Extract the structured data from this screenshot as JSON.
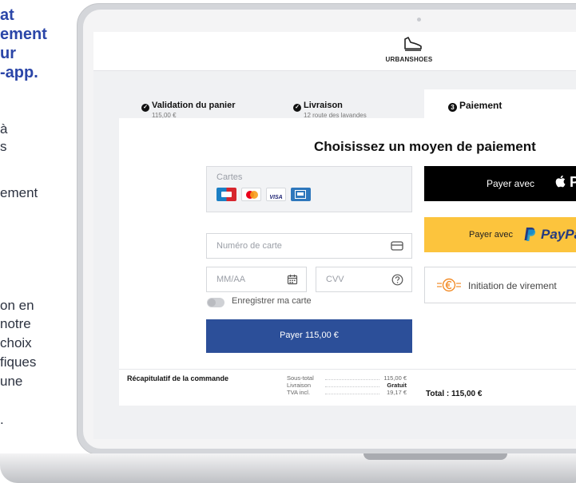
{
  "left_text": {
    "bold_lines": [
      "at",
      "ement",
      "ur",
      "-app."
    ],
    "regular_lines": [
      "à",
      "s",
      "ement",
      "on en",
      "notre",
      "choix",
      "fiques",
      "une",
      "."
    ]
  },
  "brand": {
    "name": "URBANSHOES",
    "logo_icon": "shoe-icon"
  },
  "steps": {
    "cart": {
      "title": "Validation du panier",
      "sub": "115,00 €"
    },
    "delivery": {
      "title": "Livraison",
      "sub": "12 route des lavandes"
    },
    "payment": {
      "number": "3",
      "title": "Paiement"
    }
  },
  "payment": {
    "heading": "Choisissez un moyen de paiement",
    "cards_label": "Cartes",
    "card_brands": [
      "Carte Bancaire",
      "Mastercard",
      "VISA",
      "Amex"
    ],
    "visa_text": "VISA",
    "card_number_placeholder": "Numéro de carte",
    "expiry_placeholder": "MM/AA",
    "cvv_placeholder": "CVV",
    "save_card_label": "Enregistrer ma carte",
    "pay_button": "Payer 115,00 €",
    "apple_pay": {
      "label": "Payer avec",
      "brand": " Pay"
    },
    "paypal": {
      "label": "Payer avec",
      "brand": "PayPal"
    },
    "virement": {
      "label": "Initiation de virement"
    }
  },
  "summary": {
    "title": "Récapitulatif de la commande",
    "rows": [
      {
        "label": "Sous-total",
        "value": "115,00 €"
      },
      {
        "label": "Livraison",
        "value": "Gratuit"
      },
      {
        "label": "TVA incl.",
        "value": "19,17 €"
      }
    ],
    "total": "Total : 115,00 €"
  },
  "colors": {
    "accent_blue": "#2c4f99",
    "paypal_yellow": "#fcc43d",
    "paypal_blue": "#253b80",
    "virement_orange": "#f28c28",
    "marketing_blue": "#2b46a8"
  }
}
